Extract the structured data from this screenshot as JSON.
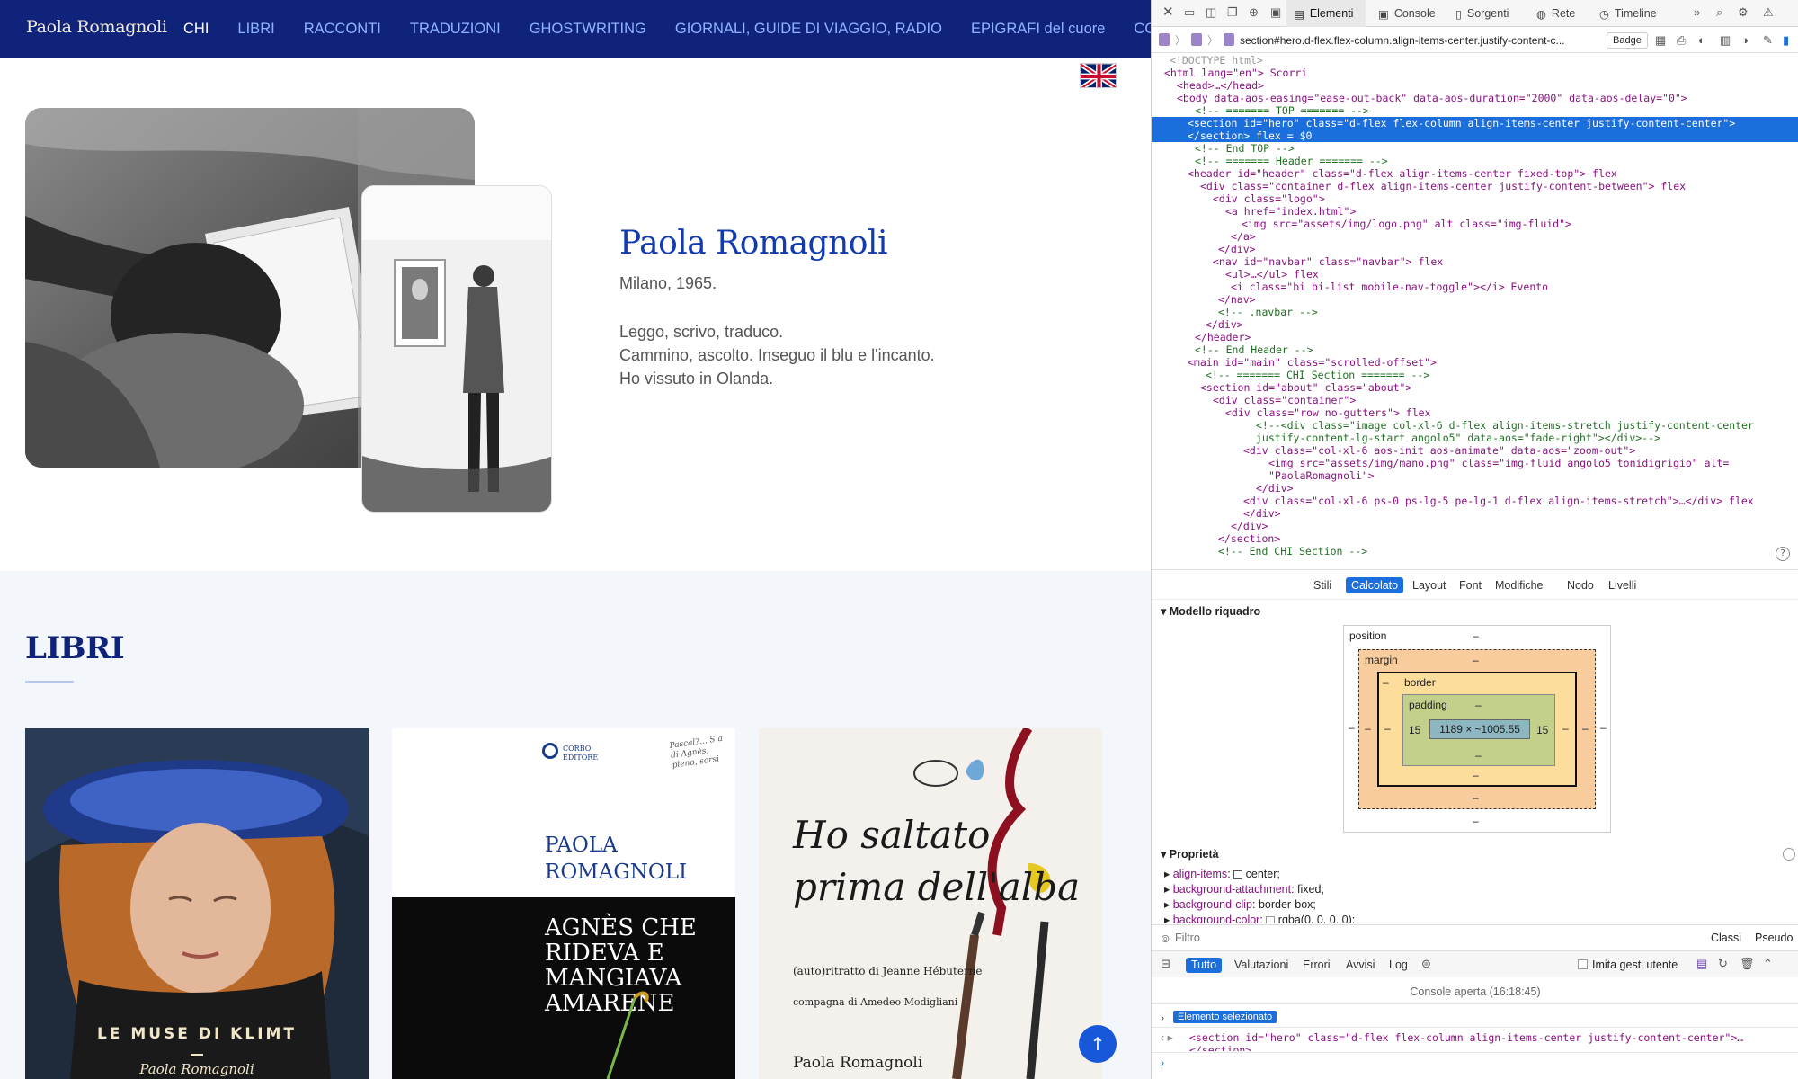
{
  "site": {
    "logo": "Paola Romagnoli",
    "nav": [
      "CHI",
      "LIBRI",
      "RACCONTI",
      "TRADUZIONI",
      "GHOSTWRITING",
      "GIORNALI, GUIDE DI VIAGGIO, RADIO",
      "EPIGRAFI del cuore",
      "CONTATTI"
    ],
    "nav_active": "CHI",
    "hero": {
      "name": "Paola Romagnoli",
      "meta": "Milano, 1965.",
      "bio": [
        "Leggo, scrivo, traduco.",
        "Cammino, ascolto. Inseguo il blu e l'incanto.",
        "Ho vissuto in Olanda."
      ]
    },
    "books_title": "LIBRI",
    "books": [
      {
        "title": "LE MUSE DI KLIMT",
        "author": "Paola Romagnoli"
      },
      {
        "publisher": "CORBO EDITORE",
        "author": "PAOLA ROMAGNOLI",
        "title": "AGNÈS CHE RIDEVA E MANGIAVA AMARENE",
        "snippet": "Pascal?... S a di Agnès, pieno, sorsi"
      },
      {
        "title": "Ho saltato prima dell'alba",
        "subtitle": "(auto)ritratto di Jeanne Hébuterne",
        "subtitle2": "compagna di Amedeo Modigliani",
        "author": "Paola Romagnoli"
      }
    ],
    "colors": {
      "nav_bg": "#10237a",
      "accent": "#123bb0",
      "up_button": "#1858d8"
    }
  },
  "devtools": {
    "tabs": [
      "Elementi",
      "Console",
      "Sorgenti",
      "Rete",
      "Timeline"
    ],
    "active_tab": "Elementi",
    "breadcrumb": "section#hero.d-flex.flex-column.align-items-center.justify-content-c...",
    "badge_label": "Badge",
    "dom_lines": [
      "<!DOCTYPE html>",
      "<html lang=\"en\"> Scorri",
      "<head>…</head>",
      "<body data-aos-easing=\"ease-out-back\" data-aos-duration=\"2000\" data-aos-delay=\"0\">",
      "<!-- ======= TOP ======= -->",
      "<section id=\"hero\" class=\"d-flex flex-column align-items-center justify-content-center\">",
      "</section> flex = $0",
      "<!-- End TOP -->",
      "<!-- ======= Header ======= -->",
      "<header id=\"header\" class=\"d-flex align-items-center fixed-top\"> flex",
      "<div class=\"container d-flex align-items-center justify-content-between\"> flex",
      "<div class=\"logo\">",
      "<a href=\"index.html\">",
      "<img src=\"assets/img/logo.png\" alt class=\"img-fluid\">",
      "</a>",
      "</div>",
      "<nav id=\"navbar\" class=\"navbar\"> flex",
      "<ul>…</ul> flex",
      "<i class=\"bi bi-list mobile-nav-toggle\"></i> Evento",
      "</nav>",
      "<!-- .navbar -->",
      "</div>",
      "</header>",
      "<!-- End Header -->",
      "<main id=\"main\" class=\"scrolled-offset\">",
      "<!-- ======= CHI Section ======= -->",
      "<section id=\"about\" class=\"about\">",
      "<div class=\"container\">",
      "<div class=\"row no-gutters\"> flex",
      "<!--<div class=\"image col-xl-6 d-flex align-items-stretch justify-content-center",
      "justify-content-lg-start angolo5\" data-aos=\"fade-right\"></div>-->",
      "<div class=\"col-xl-6 aos-init aos-animate\" data-aos=\"zoom-out\">",
      "<img src=\"assets/img/mano.png\" class=\"img-fluid angolo5 tonidigrigio\" alt=",
      "\"PaolaRomagnoli\">",
      "</div>",
      "<div class=\"col-xl-6 ps-0 ps-lg-5 pe-lg-1 d-flex align-items-stretch\">…</div> flex",
      "</div>",
      "</div>",
      "</section>",
      "<!-- End CHI Section -->"
    ],
    "subtabs": [
      "Stili",
      "Calcolato",
      "Layout",
      "Font",
      "Modifiche",
      "Nodo",
      "Livelli"
    ],
    "active_subtab": "Calcolato",
    "box_model": {
      "title": "Modello riquadro",
      "position_label": "position",
      "margin_label": "margin",
      "border_label": "border",
      "padding_label": "padding",
      "content": "1189 × ~1005.55",
      "padding_left": "15",
      "padding_right": "15",
      "dash": "–"
    },
    "properties_title": "Proprietà",
    "properties": [
      {
        "name": "align-items",
        "value": "center;"
      },
      {
        "name": "background-attachment",
        "value": "fixed;"
      },
      {
        "name": "background-clip",
        "value": "border-box;"
      },
      {
        "name": "background-color",
        "value": "rgba(0, 0, 0, 0);"
      }
    ],
    "filter_placeholder": "Filtro",
    "filter_right": [
      "Classi",
      "Pseudo"
    ],
    "console_filters": [
      "Tutto",
      "Valutazioni",
      "Errori",
      "Avvisi",
      "Log"
    ],
    "console_active": "Tutto",
    "console_checkbox": "Imita gesti utente",
    "console_opened": "Console aperta (16:18:45)",
    "console_selected_label": "Elemento selezionato",
    "console_output": "<section id=\"hero\" class=\"d-flex flex-column align-items-center justify-content-center\">…",
    "console_output2": "</section>"
  }
}
